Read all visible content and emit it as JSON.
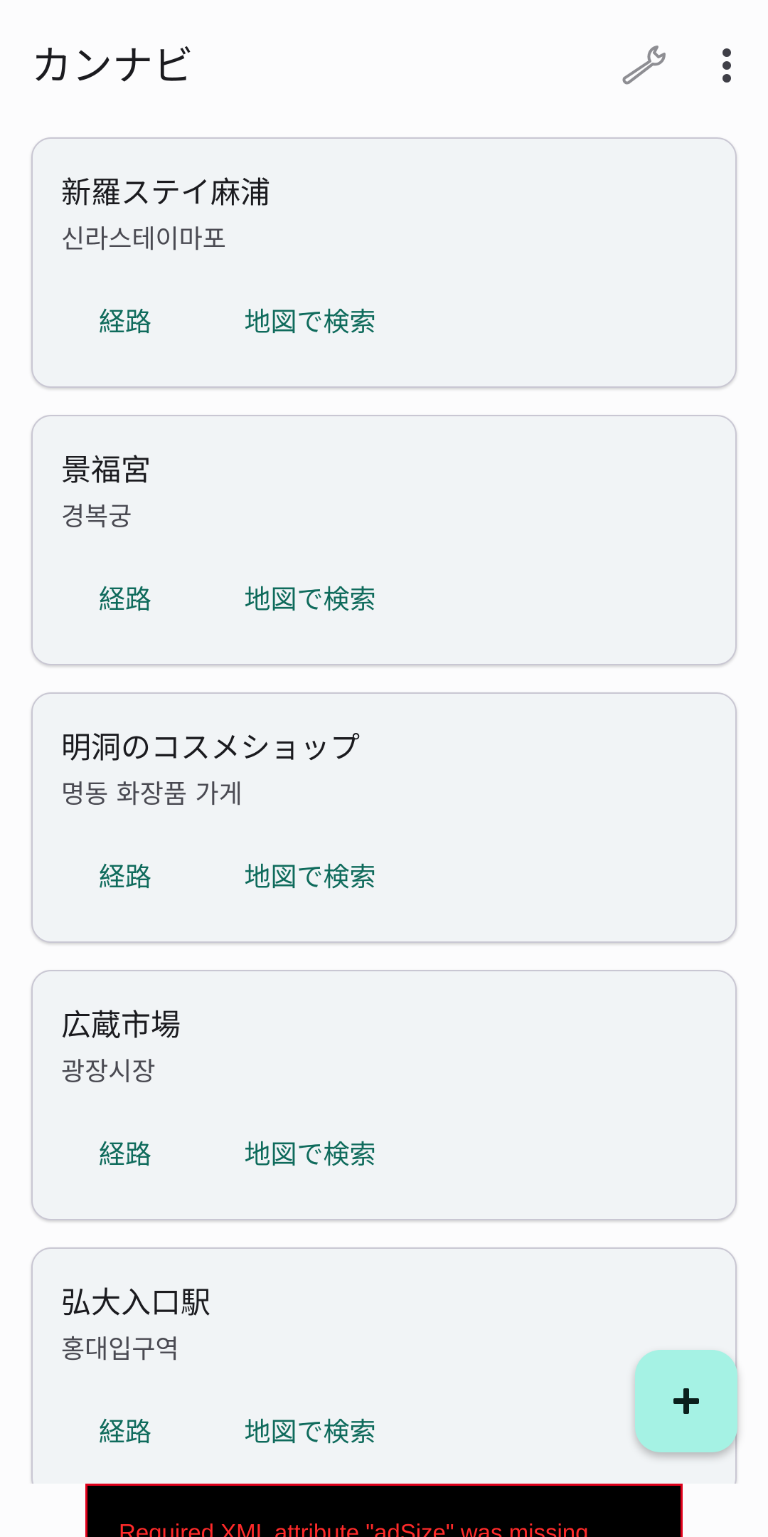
{
  "app": {
    "title": "カンナビ"
  },
  "toolbar": {
    "settings_icon": "wrench-icon",
    "overflow_icon": "more-vert-icon"
  },
  "places": [
    {
      "name": "新羅ステイ麻浦",
      "native": "신라스테이마포",
      "route_label": "経路",
      "map_label": "地図で検索"
    },
    {
      "name": "景福宮",
      "native": "경복궁",
      "route_label": "経路",
      "map_label": "地図で検索"
    },
    {
      "name": "明洞のコスメショップ",
      "native": "명동 화장품 가게",
      "route_label": "経路",
      "map_label": "地図で検索"
    },
    {
      "name": "広蔵市場",
      "native": "광장시장",
      "route_label": "経路",
      "map_label": "地図で検索"
    },
    {
      "name": "弘大入口駅",
      "native": "홍대입구역",
      "route_label": "経路",
      "map_label": "地図で検索"
    }
  ],
  "fab": {
    "icon": "add-icon"
  },
  "ad": {
    "message": "Required XML attribute \"adSize\" was missing."
  },
  "colors": {
    "accent": "#0f6b5c",
    "fab": "#a5f2e4",
    "card_bg": "#f1f4f6",
    "error": "#ff2a2a"
  }
}
